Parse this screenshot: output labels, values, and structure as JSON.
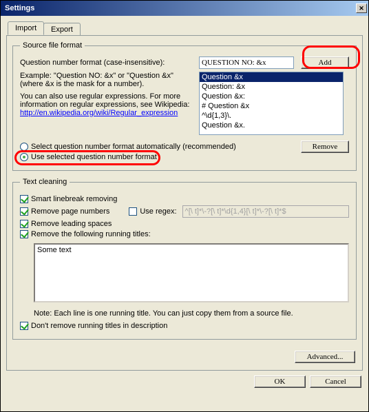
{
  "window": {
    "title": "Settings"
  },
  "tabs": {
    "import": "Import",
    "export": "Export"
  },
  "sourceFormat": {
    "legend": "Source file format",
    "qnLabel": "Question number format (case-insensitive):",
    "qnValue": "QUESTION NO: &x",
    "addBtn": "Add",
    "example": "Example: \"Question NO: &x\" or \"Question &x\" (where &x is the mask for a number).",
    "regexNote1": "You can also use regular expressions. For more information on regular expressions, see Wikipedia:",
    "regexLink": "http://en.wikipedia.org/wiki/Regular_expression",
    "listItems": [
      "Question &x",
      "Question: &x",
      "Question &x:",
      "# Question &x",
      "^\\d{1,3}\\.",
      "Question &x."
    ],
    "radioAuto": "Select question number format automatically (recommended)",
    "radioSelected": "Use selected question number format",
    "removeBtn": "Remove"
  },
  "textCleaning": {
    "legend": "Text cleaning",
    "smartLinebreak": "Smart linebreak removing",
    "removePage": "Remove page numbers",
    "useRegex": "Use regex:",
    "regexValue": "^[\\ t]*\\-?[\\ t]*\\d{1,4}[\\ t]*\\-?[\\ t]*$",
    "removeLeading": "Remove leading spaces",
    "removeTitles": "Remove the following running titles:",
    "titlesText": "Some text",
    "note": "Note: Each line is one running title. You can just copy them from a source file.",
    "dontRemoveDesc": "Don't remove running titles in description"
  },
  "buttons": {
    "advanced": "Advanced...",
    "ok": "OK",
    "cancel": "Cancel"
  }
}
